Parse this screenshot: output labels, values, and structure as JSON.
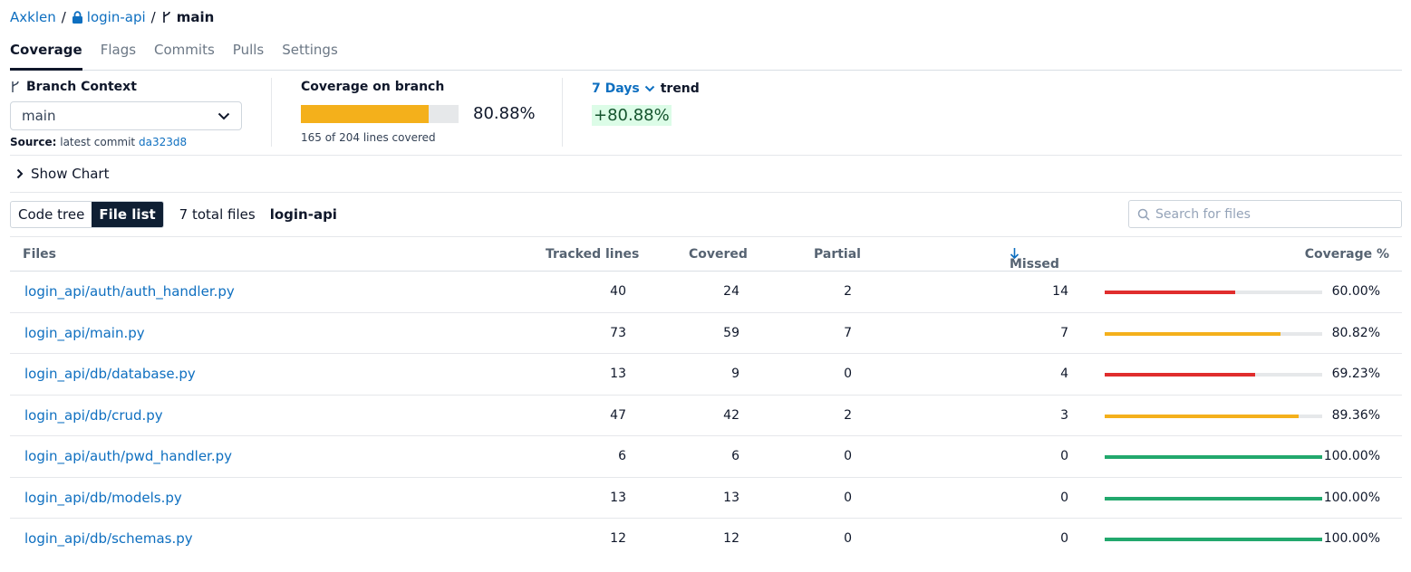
{
  "breadcrumb": {
    "owner": "Axklen",
    "repo": "login-api",
    "branch": "main"
  },
  "tabs": [
    {
      "label": "Coverage",
      "active": true
    },
    {
      "label": "Flags",
      "active": false
    },
    {
      "label": "Commits",
      "active": false
    },
    {
      "label": "Pulls",
      "active": false
    },
    {
      "label": "Settings",
      "active": false
    }
  ],
  "branch_context": {
    "title": "Branch Context",
    "selected": "main",
    "source_label": "Source:",
    "source_text": "latest commit",
    "commit": "da323d8"
  },
  "coverage": {
    "title": "Coverage on branch",
    "percent": 80.88,
    "percent_label": "80.88%",
    "lines_text": "165 of 204 lines covered",
    "bar_color": "#f4b01b"
  },
  "trend": {
    "period": "7 Days",
    "label": "trend",
    "value": "+80.88%"
  },
  "show_chart": "Show Chart",
  "toolbar": {
    "view_options": [
      "Code tree",
      "File list"
    ],
    "active_view": "File list",
    "total_files": "7 total files",
    "repo_name": "login-api",
    "search_placeholder": "Search for files"
  },
  "table": {
    "headers": {
      "files": "Files",
      "tracked": "Tracked lines",
      "covered": "Covered",
      "partial": "Partial",
      "missed": "Missed",
      "coverage": "Coverage %"
    },
    "rows": [
      {
        "file": "login_api/auth/auth_handler.py",
        "tracked": "40",
        "covered": "24",
        "partial": "2",
        "missed": "14",
        "pct": "60.00%",
        "value": 60.0,
        "color": "#e02d2d"
      },
      {
        "file": "login_api/main.py",
        "tracked": "73",
        "covered": "59",
        "partial": "7",
        "missed": "7",
        "pct": "80.82%",
        "value": 80.82,
        "color": "#f4b01b"
      },
      {
        "file": "login_api/db/database.py",
        "tracked": "13",
        "covered": "9",
        "partial": "0",
        "missed": "4",
        "pct": "69.23%",
        "value": 69.23,
        "color": "#e02d2d"
      },
      {
        "file": "login_api/db/crud.py",
        "tracked": "47",
        "covered": "42",
        "partial": "2",
        "missed": "3",
        "pct": "89.36%",
        "value": 89.36,
        "color": "#f4b01b"
      },
      {
        "file": "login_api/auth/pwd_handler.py",
        "tracked": "6",
        "covered": "6",
        "partial": "0",
        "missed": "0",
        "pct": "100.00%",
        "value": 100.0,
        "color": "#22a86d"
      },
      {
        "file": "login_api/db/models.py",
        "tracked": "13",
        "covered": "13",
        "partial": "0",
        "missed": "0",
        "pct": "100.00%",
        "value": 100.0,
        "color": "#22a86d"
      },
      {
        "file": "login_api/db/schemas.py",
        "tracked": "12",
        "covered": "12",
        "partial": "0",
        "missed": "0",
        "pct": "100.00%",
        "value": 100.0,
        "color": "#22a86d"
      }
    ]
  }
}
